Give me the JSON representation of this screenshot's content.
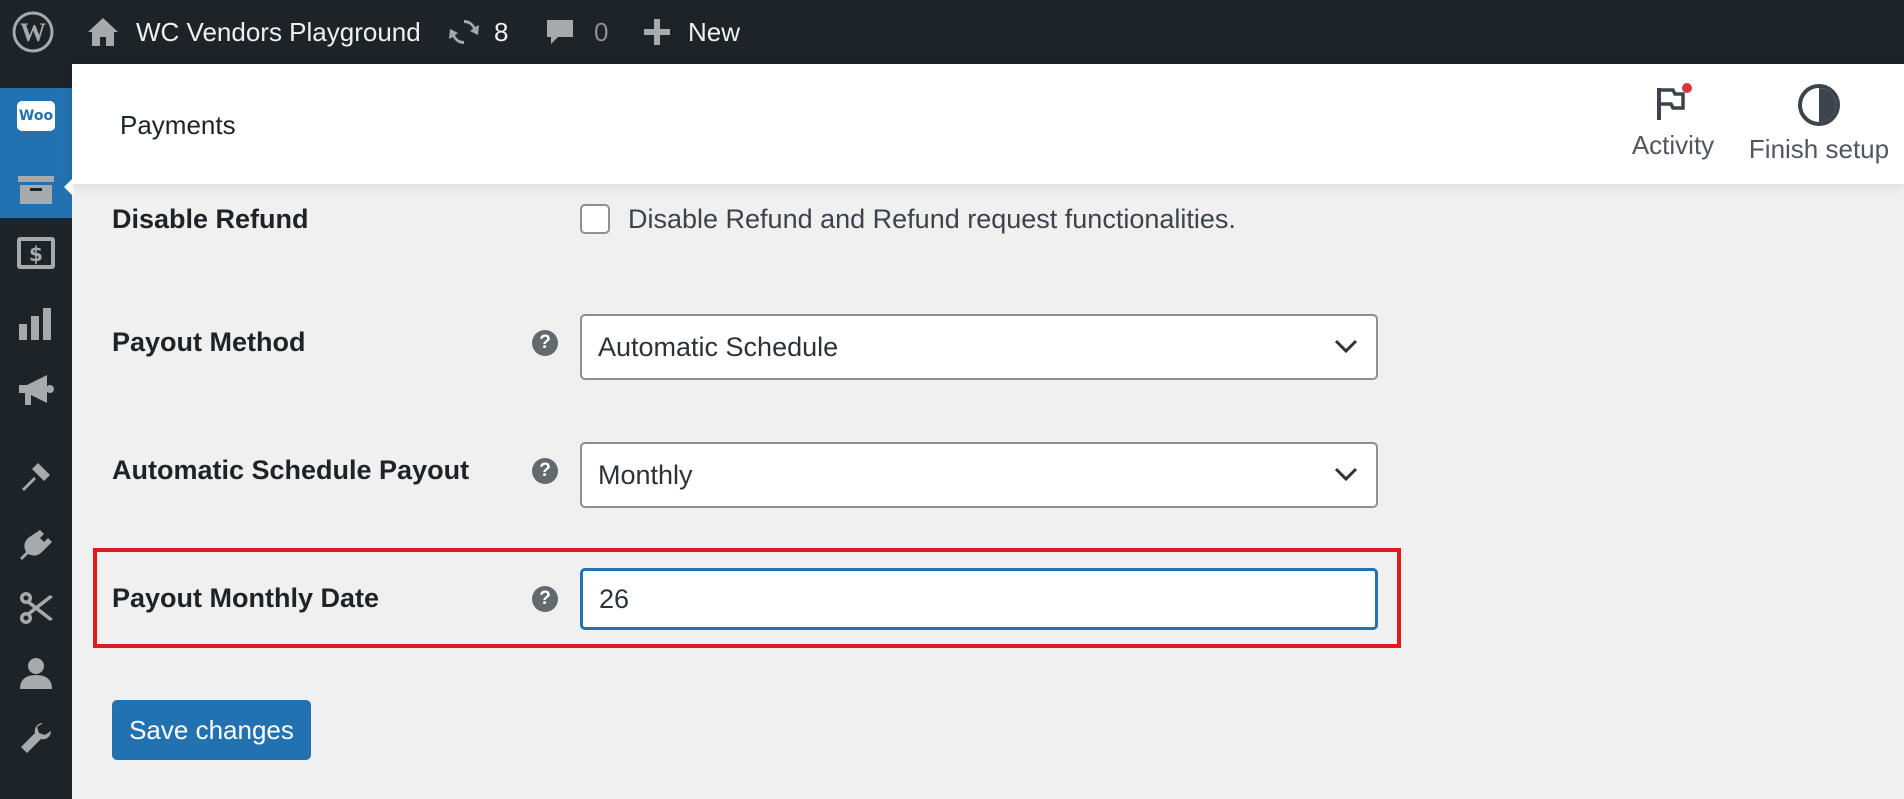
{
  "adminbar": {
    "site_name": "WC Vendors Playground",
    "updates_count": "8",
    "comments_count": "0",
    "new_label": "New"
  },
  "sidebar": {
    "active_logo_text": "Woo",
    "icons": [
      "woo-icon",
      "archive-icon",
      "money-icon",
      "chart-icon",
      "megaphone-icon",
      "brush-icon",
      "plugin-icon",
      "tools-icon",
      "users-icon",
      "wrench-icon"
    ]
  },
  "header": {
    "title": "Payments",
    "activity_label": "Activity",
    "finish_setup_label": "Finish setup"
  },
  "form": {
    "disable_refund": {
      "label": "Disable Refund",
      "checkbox_text": "Disable Refund and Refund request functionalities.",
      "checked": false
    },
    "payout_method": {
      "label": "Payout Method",
      "help": "?",
      "value": "Automatic Schedule"
    },
    "schedule_payout": {
      "label": "Automatic Schedule Payout",
      "help": "?",
      "value": "Monthly"
    },
    "monthly_date": {
      "label": "Payout Monthly Date",
      "help": "?",
      "value": "26"
    },
    "save_label": "Save changes"
  },
  "colors": {
    "adminbar_bg": "#1d2327",
    "accent": "#2271b1",
    "highlight_border": "#e31a1c",
    "notification_dot": "#d63638"
  }
}
